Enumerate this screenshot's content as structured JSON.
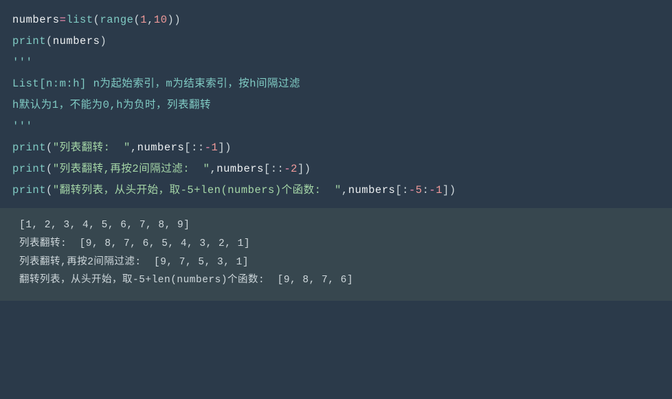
{
  "code": {
    "l1": {
      "var": "numbers",
      "op": "=",
      "fn1": "list",
      "lp1": "(",
      "fn2": "range",
      "lp2": "(",
      "n1": "1",
      "comma": ",",
      "n2": "10",
      "rp2": ")",
      "rp1": ")"
    },
    "l2": {
      "fn": "print",
      "lp": "(",
      "arg": "numbers",
      "rp": ")"
    },
    "l3": "'''",
    "l4": "List[n:m:h] n为起始索引，m为结束索引，按h间隔过滤",
    "l5": "h默认为1，不能为0,h为负时，列表翻转",
    "l6": "'''",
    "l7": {
      "fn": "print",
      "lp": "(",
      "str": "\"列表翻转:  \"",
      "comma": ",",
      "var": "numbers",
      "lb": "[",
      "c1": ":",
      "c2": ":",
      "minus": "-",
      "n": "1",
      "rb": "]",
      "rp": ")"
    },
    "l8": {
      "fn": "print",
      "lp": "(",
      "str": "\"列表翻转,再按2间隔过滤:  \"",
      "comma": ",",
      "var": "numbers",
      "lb": "[",
      "c1": ":",
      "c2": ":",
      "minus": "-",
      "n": "2",
      "rb": "]",
      "rp": ")"
    },
    "l9": {
      "fn": "print",
      "lp": "(",
      "str": "\"翻转列表，从头开始，取-5+len(numbers)个函数:  \"",
      "comma": ",",
      "var": "numbers",
      "lb": "[",
      "c1": ":",
      "minus1": "-",
      "n1": "5",
      "c2": ":",
      "minus2": "-",
      "n2": "1",
      "rb": "]",
      "rp": ")"
    }
  },
  "output": {
    "o1": "[1, 2, 3, 4, 5, 6, 7, 8, 9]",
    "o2": "列表翻转:  [9, 8, 7, 6, 5, 4, 3, 2, 1]",
    "o3": "列表翻转,再按2间隔过滤:  [9, 7, 5, 3, 1]",
    "o4": "翻转列表，从头开始，取-5+len(numbers)个函数:  [9, 8, 7, 6]"
  }
}
